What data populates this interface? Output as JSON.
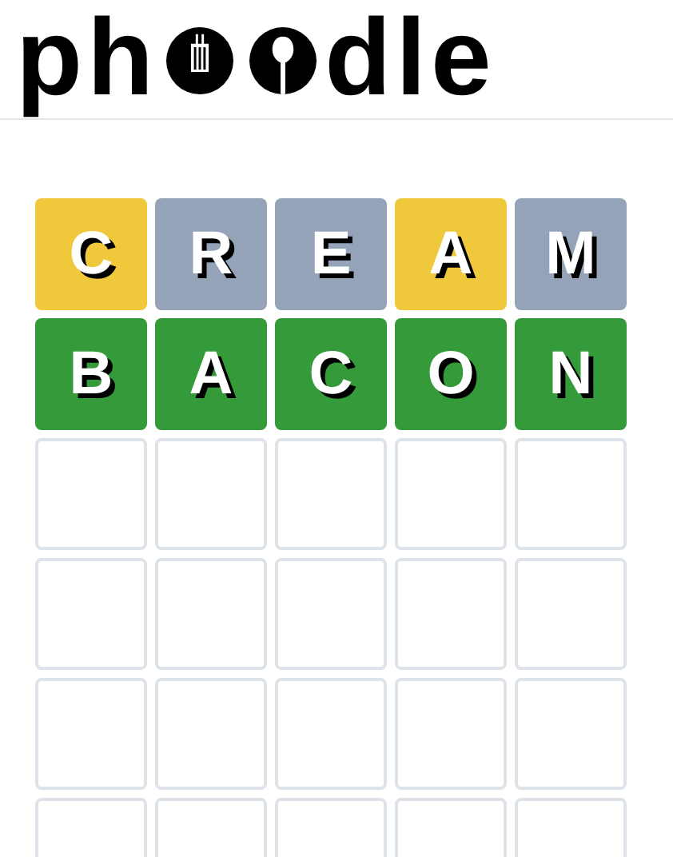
{
  "logo": {
    "before": "ph",
    "after": "dle"
  },
  "board": {
    "rows": [
      {
        "tiles": [
          {
            "kind": "filled",
            "letter": "C",
            "color": "#efc83b"
          },
          {
            "kind": "filled",
            "letter": "R",
            "color": "#94a3b8"
          },
          {
            "kind": "filled",
            "letter": "E",
            "color": "#94a3b8"
          },
          {
            "kind": "filled",
            "letter": "A",
            "color": "#efc83b"
          },
          {
            "kind": "filled",
            "letter": "M",
            "color": "#94a3b8"
          }
        ]
      },
      {
        "tiles": [
          {
            "kind": "filled",
            "letter": "B",
            "color": "#359a3a"
          },
          {
            "kind": "filled",
            "letter": "A",
            "color": "#359a3a"
          },
          {
            "kind": "filled",
            "letter": "C",
            "color": "#359a3a"
          },
          {
            "kind": "filled",
            "letter": "O",
            "color": "#359a3a"
          },
          {
            "kind": "filled",
            "letter": "N",
            "color": "#359a3a"
          }
        ]
      },
      {
        "tiles": [
          {
            "kind": "blank"
          },
          {
            "kind": "blank"
          },
          {
            "kind": "blank"
          },
          {
            "kind": "blank"
          },
          {
            "kind": "blank"
          }
        ]
      },
      {
        "tiles": [
          {
            "kind": "blank"
          },
          {
            "kind": "blank"
          },
          {
            "kind": "blank"
          },
          {
            "kind": "blank"
          },
          {
            "kind": "blank"
          }
        ]
      },
      {
        "tiles": [
          {
            "kind": "blank"
          },
          {
            "kind": "blank"
          },
          {
            "kind": "blank"
          },
          {
            "kind": "blank"
          },
          {
            "kind": "blank"
          }
        ]
      },
      {
        "tiles": [
          {
            "kind": "blank"
          },
          {
            "kind": "blank"
          },
          {
            "kind": "blank"
          },
          {
            "kind": "blank"
          },
          {
            "kind": "blank"
          }
        ]
      }
    ]
  }
}
